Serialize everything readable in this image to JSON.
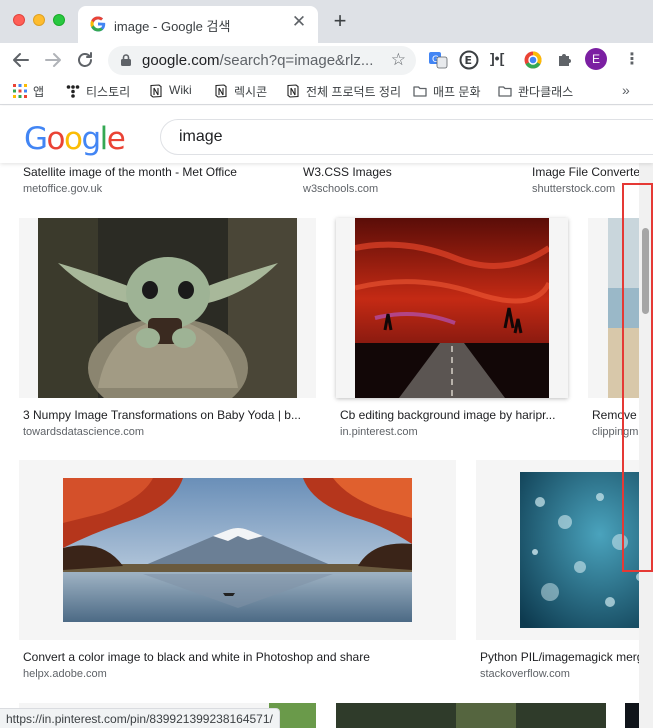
{
  "browser": {
    "tab_title": "image - Google 검색",
    "tab_close": "✕",
    "new_tab": "+",
    "url_host": "google.com",
    "url_rest": "/search?q=image&rlz...",
    "star": "☆",
    "ext_text": "]•[",
    "profile_initial": "E",
    "menu": "⋮"
  },
  "bookmarks": {
    "items": [
      {
        "label": "앱",
        "icon": "apps-grid-icon"
      },
      {
        "label": "티스토리",
        "icon": "tistory-icon"
      },
      {
        "label": "Wiki",
        "icon": "notion-icon"
      },
      {
        "label": "렉시콘",
        "icon": "notion-icon"
      },
      {
        "label": "전체 프로덕트 정리",
        "icon": "notion-icon"
      },
      {
        "label": "매프 문화",
        "icon": "folder-icon"
      },
      {
        "label": "콴다클래스",
        "icon": "folder-icon"
      }
    ],
    "more": "»"
  },
  "google": {
    "logo": [
      "G",
      "o",
      "o",
      "g",
      "l",
      "e"
    ],
    "logo_colors": [
      "#4285F4",
      "#EA4335",
      "#FBBC05",
      "#4285F4",
      "#34A853",
      "#EA4335"
    ],
    "query": "image"
  },
  "results": [
    {
      "title": "Satellite image of the month - Met Office",
      "source": "metoffice.gov.uk"
    },
    {
      "title": "W3.CSS Images",
      "source": "w3schools.com"
    },
    {
      "title": "Image File Converter -",
      "source": "shutterstock.com"
    },
    {
      "title": "3 Numpy Image Transformations on Baby Yoda | b...",
      "source": "towardsdatascience.com"
    },
    {
      "title": "Cb editing background image by haripr...",
      "source": "in.pinterest.com"
    },
    {
      "title": "Remove Im",
      "source": "clippingmag"
    },
    {
      "title": "Convert a color image to black and white in Photoshop and share",
      "source": "helpx.adobe.com"
    },
    {
      "title": "Python PIL/imagemagick merg",
      "source": "stackoverflow.com"
    }
  ],
  "status_url": "https://in.pinterest.com/pin/839921399238164571/"
}
